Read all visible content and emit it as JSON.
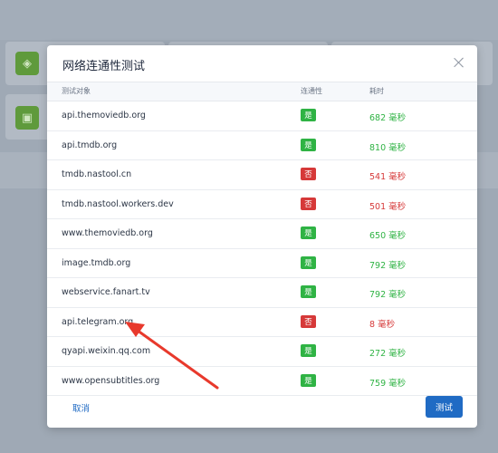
{
  "modal": {
    "title": "网络连通性测试",
    "columns": {
      "target": "测试对象",
      "connectivity": "连通性",
      "time": "耗时"
    },
    "rows": [
      {
        "target": "api.themoviedb.org",
        "status": "是",
        "ok": true,
        "time": "682 毫秒"
      },
      {
        "target": "api.tmdb.org",
        "status": "是",
        "ok": true,
        "time": "810 毫秒"
      },
      {
        "target": "tmdb.nastool.cn",
        "status": "否",
        "ok": false,
        "time": "541 毫秒"
      },
      {
        "target": "tmdb.nastool.workers.dev",
        "status": "否",
        "ok": false,
        "time": "501 毫秒"
      },
      {
        "target": "www.themoviedb.org",
        "status": "是",
        "ok": true,
        "time": "650 毫秒"
      },
      {
        "target": "image.tmdb.org",
        "status": "是",
        "ok": true,
        "time": "792 毫秒"
      },
      {
        "target": "webservice.fanart.tv",
        "status": "是",
        "ok": true,
        "time": "792 毫秒"
      },
      {
        "target": "api.telegram.org",
        "status": "否",
        "ok": false,
        "time": "8 毫秒"
      },
      {
        "target": "qyapi.weixin.qq.com",
        "status": "是",
        "ok": true,
        "time": "272 毫秒"
      },
      {
        "target": "www.opensubtitles.org",
        "status": "是",
        "ok": true,
        "time": "759 毫秒"
      }
    ],
    "cancel_label": "取消",
    "test_label": "测试"
  },
  "colors": {
    "success": "#2fb344",
    "danger": "#d63939",
    "primary": "#206bc4",
    "annotation": "#e8392c"
  },
  "icons": {
    "close": "close-icon"
  }
}
